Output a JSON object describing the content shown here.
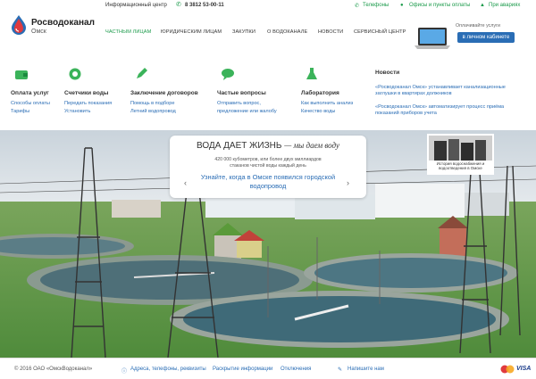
{
  "topbar": {
    "info_center": "Информационный центр",
    "phone": "8 3812 53-00-11",
    "phones": "Телефоны",
    "offices": "Офисы и пункты оплаты",
    "accidents": "При авариях"
  },
  "logo": {
    "name": "Росводоканал",
    "city": "Омск"
  },
  "nav": {
    "items": [
      "ЧАСТНЫМ ЛИЦАМ",
      "ЮРИДИЧЕСКИМ ЛИЦАМ",
      "ЗАКУПКИ",
      "О ВОДОКАНАЛЕ",
      "НОВОСТИ",
      "СЕРВИСНЫЙ ЦЕНТР"
    ]
  },
  "payment": {
    "label": "Оплачивайте услуги",
    "button": "в личном кабинете"
  },
  "menu": [
    {
      "title": "Оплата услуг",
      "links": [
        "Способы оплаты",
        "Тарифы"
      ]
    },
    {
      "title": "Счетчики воды",
      "links": [
        "Передать показания",
        "Установить"
      ]
    },
    {
      "title": "Заключение договоров",
      "links": [
        "Помощь в подборе",
        "Летний водопровод"
      ]
    },
    {
      "title": "Частые вопросы",
      "links": [
        "Отправить вопрос,",
        "предложение или жалобу"
      ]
    },
    {
      "title": "Лаборатория",
      "links": [
        "Как выполнить анализ",
        "Качество воды"
      ]
    }
  ],
  "news": {
    "title": "Новости",
    "items": [
      "«Росводоканал Омск» устанавливает канализационные заглушки в квартирах должников",
      "«Росводоканал Омск» автоматизирует процесс приёма показаний приборов учета"
    ]
  },
  "hero": {
    "headline": "ВОДА ДАЕТ ЖИЗНЬ",
    "headline_tail": "— мы даем воду",
    "sub": "420 000 кубометров, или более двух миллиардов стаканов чистой воды каждый день",
    "link": "Узнайте, когда в Омске появился городской водопровод",
    "history_caption": "История водоснабжения и водоотведения в Омске"
  },
  "footer": {
    "copyright": "© 2016 ОАО «ОмскВодоканал»",
    "contacts": "Адреса, телефоны, реквизиты",
    "disclosure": "Раскрытие информации",
    "shutdowns": "Отключения",
    "write": "Напишите нам",
    "visa": "VISA"
  },
  "colors": {
    "accent": "#1a9a4a",
    "link": "#2a6db5",
    "brand_red": "#e03a3e"
  }
}
